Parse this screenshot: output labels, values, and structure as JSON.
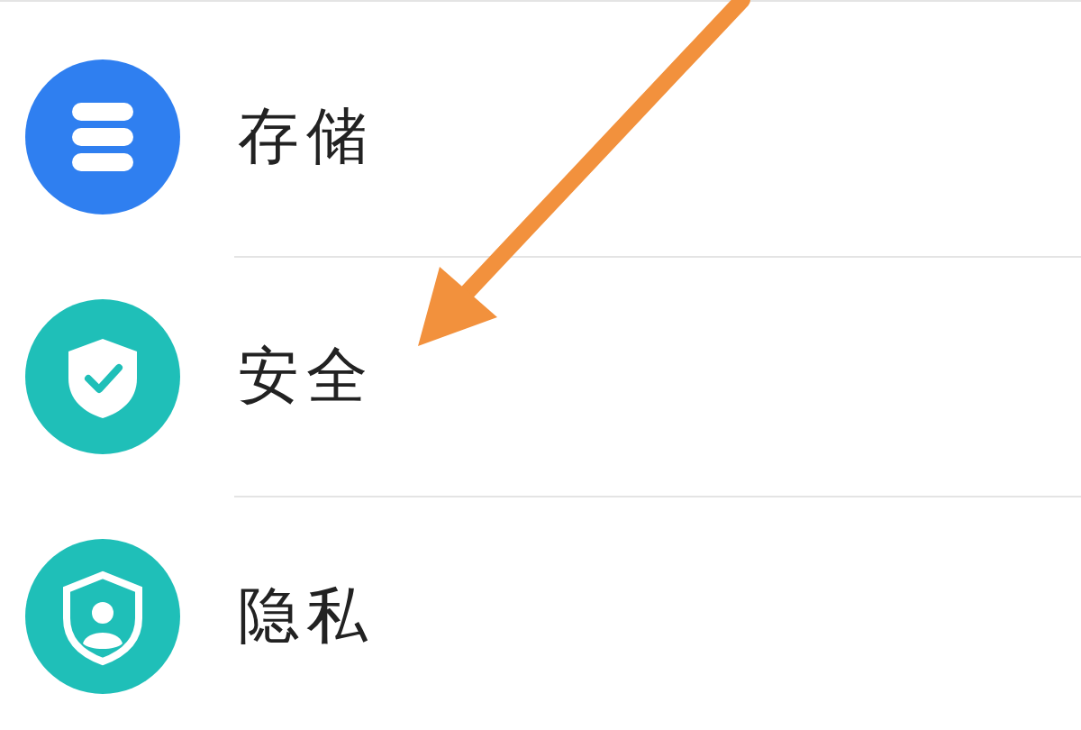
{
  "items": [
    {
      "label": "存储",
      "kind": "storage",
      "color": "#2f7ff0"
    },
    {
      "label": "安全",
      "kind": "security",
      "color": "#1fbfb8"
    },
    {
      "label": "隐私",
      "kind": "privacy",
      "color": "#1fbfb8"
    }
  ]
}
